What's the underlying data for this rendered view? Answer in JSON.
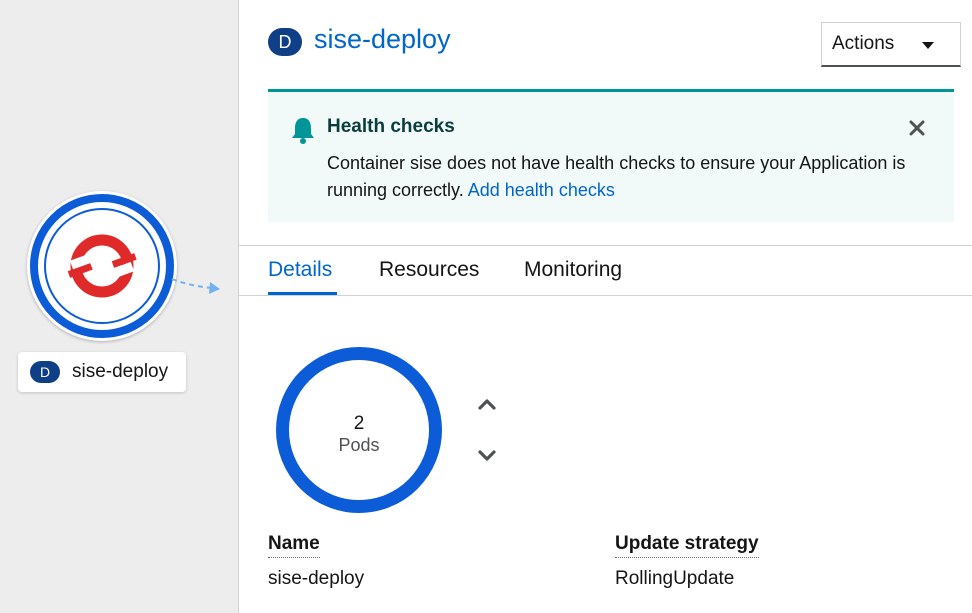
{
  "topology": {
    "node": {
      "badge": "D",
      "label": "sise-deploy",
      "icon": "openshift-logo-icon",
      "ring_color": "#0b5cd6"
    },
    "edge_icon": "dashed-arrow-icon"
  },
  "panel": {
    "header": {
      "badge": "D",
      "title": "sise-deploy",
      "actions_label": "Actions"
    },
    "alert": {
      "icon": "bell-icon",
      "title": "Health checks",
      "message": "Container sise does not have health checks to ensure your Application is running correctly.",
      "link": "Add health checks",
      "accent_color": "#009596"
    },
    "tabs": [
      {
        "label": "Details",
        "active": true
      },
      {
        "label": "Resources",
        "active": false
      },
      {
        "label": "Monitoring",
        "active": false
      }
    ],
    "pods": {
      "count": "2",
      "label": "Pods"
    },
    "details": {
      "name_label": "Name",
      "name_value": "sise-deploy",
      "strategy_label": "Update strategy",
      "strategy_value": "RollingUpdate"
    }
  },
  "colors": {
    "link": "#0066cc",
    "badge_bg": "#0f3f86",
    "canvas_bg": "#ededed"
  }
}
